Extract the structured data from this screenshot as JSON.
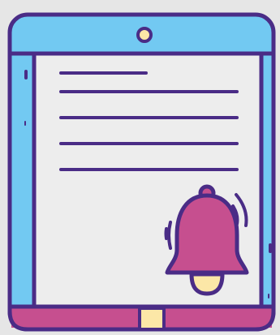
{
  "illustration": {
    "subject": "tablet-with-notification-bell",
    "icons": {
      "device": "tablet-icon",
      "camera": "camera-icon",
      "document": "document-icon",
      "bell": "bell-icon",
      "home_button": "home-button-icon"
    },
    "colors": {
      "background": "#E6E6E6",
      "outline": "#4A2C86",
      "frame": "#72C9F2",
      "screen": "#EDEDED",
      "bottom_bar": "#C64F8F",
      "bell": "#C64F8F",
      "clapper": "#FCE7A7",
      "home_button": "#FCE7A7"
    },
    "document_line_count": 5
  }
}
